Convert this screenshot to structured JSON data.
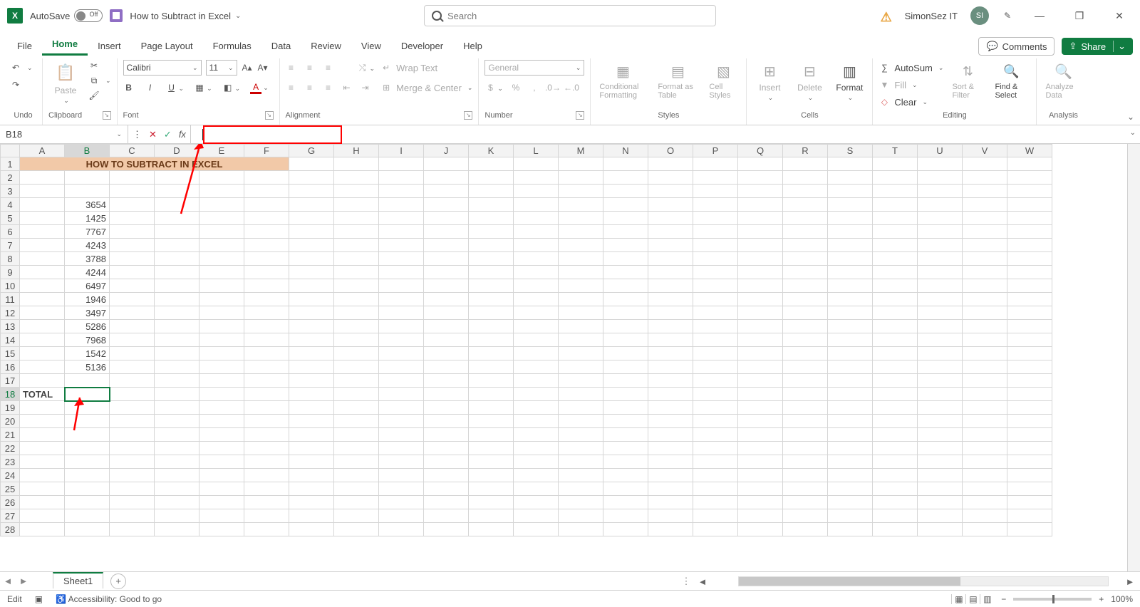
{
  "titlebar": {
    "autosave_label": "AutoSave",
    "autosave_state": "Off",
    "doc_name": "How to Subtract in Excel",
    "search_placeholder": "Search",
    "account_name": "SimonSez IT",
    "account_initials": "SI"
  },
  "tabs": {
    "file": "File",
    "home": "Home",
    "insert": "Insert",
    "page_layout": "Page Layout",
    "formulas": "Formulas",
    "data": "Data",
    "review": "Review",
    "view": "View",
    "developer": "Developer",
    "help": "Help",
    "comments": "Comments",
    "share": "Share"
  },
  "ribbon": {
    "undo": {
      "group": "Undo"
    },
    "clipboard": {
      "group": "Clipboard",
      "paste": "Paste"
    },
    "font": {
      "group": "Font",
      "name": "Calibri",
      "size": "11"
    },
    "alignment": {
      "group": "Alignment",
      "wrap": "Wrap Text",
      "merge": "Merge & Center"
    },
    "number": {
      "group": "Number",
      "format": "General"
    },
    "styles": {
      "group": "Styles",
      "conditional": "Conditional Formatting",
      "table": "Format as Table",
      "cell": "Cell Styles"
    },
    "cells": {
      "group": "Cells",
      "insert": "Insert",
      "delete": "Delete",
      "format": "Format"
    },
    "editing": {
      "group": "Editing",
      "autosum": "AutoSum",
      "fill": "Fill",
      "clear": "Clear",
      "sort": "Sort & Filter",
      "find": "Find & Select"
    },
    "analysis": {
      "group": "Analysis",
      "analyze": "Analyze Data"
    }
  },
  "fxbar": {
    "namebox": "B18",
    "formula": ""
  },
  "columns": [
    "A",
    "B",
    "C",
    "D",
    "E",
    "F",
    "G",
    "H",
    "I",
    "J",
    "K",
    "L",
    "M",
    "N",
    "O",
    "P",
    "Q",
    "R",
    "S",
    "T",
    "U",
    "V",
    "W"
  ],
  "rows": {
    "count": 28,
    "banner_text": "HOW TO SUBTRACT IN EXCEL",
    "data": {
      "4": 3654,
      "5": 1425,
      "6": 7767,
      "7": 4243,
      "8": 3788,
      "9": 4244,
      "10": 6497,
      "11": 1946,
      "12": 3497,
      "13": 5286,
      "14": 7968,
      "15": 1542,
      "16": 5136
    },
    "total_row": 18,
    "total_label": "TOTAL",
    "selected_cell": "B18"
  },
  "sheettabs": {
    "sheet1": "Sheet1"
  },
  "statusbar": {
    "mode": "Edit",
    "accessibility": "Accessibility: Good to go",
    "zoom": "100%"
  }
}
